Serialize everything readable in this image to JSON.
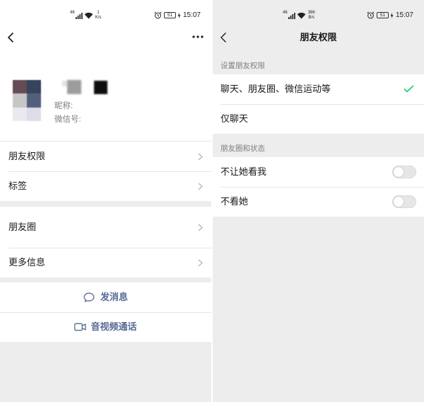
{
  "left": {
    "status_bar": {
      "network_type": "46",
      "speed_value": "1",
      "speed_unit": "K/s",
      "battery_level": "51",
      "time": "15:07"
    },
    "profile": {
      "nickname_label": "昵称:",
      "wechat_id_label": "微信号:"
    },
    "menu": [
      {
        "label": "朋友权限"
      },
      {
        "label": "标签"
      },
      {
        "label": "朋友圈"
      },
      {
        "label": "更多信息"
      }
    ],
    "actions": {
      "message_label": "发消息",
      "call_label": "音视频通话"
    }
  },
  "right": {
    "status_bar": {
      "network_type": "46",
      "speed_value": "386",
      "speed_unit": "B/s",
      "battery_level": "51",
      "time": "15:07"
    },
    "title": "朋友权限",
    "section_permissions": {
      "label": "设置朋友权限",
      "options": [
        {
          "label": "聊天、朋友圈、微信运动等",
          "selected": true
        },
        {
          "label": "仅聊天",
          "selected": false
        }
      ]
    },
    "section_moments": {
      "label": "朋友圈和状态",
      "toggles": [
        {
          "label": "不让她看我",
          "on": false
        },
        {
          "label": "不看她",
          "on": false
        }
      ]
    }
  },
  "icons": {
    "back": "chevron-left-icon",
    "more": "more-dots-icon",
    "row_arrow": "chevron-right-icon",
    "message": "chat-bubble-icon",
    "call": "video-camera-icon",
    "selected": "check-icon",
    "signal": "signal-icon",
    "wifi": "wifi-icon",
    "alarm": "alarm-icon",
    "battery": "battery-icon",
    "charging": "bolt-icon"
  },
  "colors": {
    "bg": "#ededed",
    "surface": "#ffffff",
    "text": "#191919",
    "secondary": "#7f7f7f",
    "link": "#576b95",
    "accent": "#07c160",
    "divider": "#e5e5e5",
    "chevron": "#b2b2b2"
  }
}
